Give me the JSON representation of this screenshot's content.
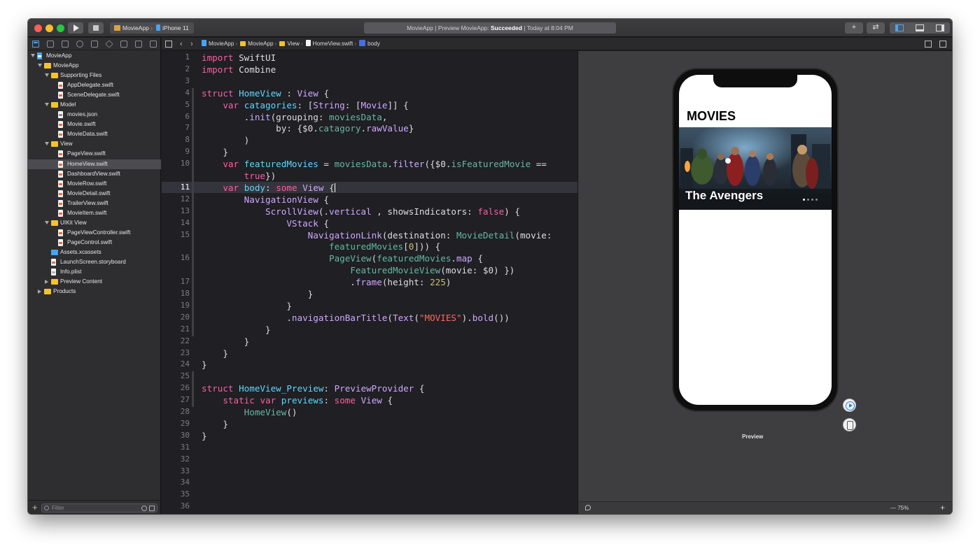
{
  "titlebar": {
    "scheme": "MovieApp",
    "device": "iPhone 11",
    "activity_prefix": "MovieApp | Preview MovieApp: ",
    "activity_status": "Succeeded",
    "activity_suffix": " | Today at 8:04 PM",
    "add_label": "+",
    "swap_label": "⇄"
  },
  "navigator": {
    "items": [
      {
        "label": "MovieApp",
        "kind": "project",
        "depth": 0,
        "disclosure": "open"
      },
      {
        "label": "MovieApp",
        "kind": "folder",
        "depth": 1,
        "disclosure": "open"
      },
      {
        "label": "Supporting Files",
        "kind": "folder",
        "depth": 2,
        "disclosure": "open"
      },
      {
        "label": "AppDelegate.swift",
        "kind": "swift",
        "depth": 3
      },
      {
        "label": "SceneDelegate.swift",
        "kind": "swift",
        "depth": 3
      },
      {
        "label": "Model",
        "kind": "folder",
        "depth": 2,
        "disclosure": "open"
      },
      {
        "label": "movies.json",
        "kind": "json",
        "depth": 3
      },
      {
        "label": "Movie.swift",
        "kind": "swift",
        "depth": 3
      },
      {
        "label": "MovieData.swift",
        "kind": "swift",
        "depth": 3
      },
      {
        "label": "View",
        "kind": "folder",
        "depth": 2,
        "disclosure": "open"
      },
      {
        "label": "PageView.swift",
        "kind": "swift",
        "depth": 3
      },
      {
        "label": "HomeView.swift",
        "kind": "swift",
        "depth": 3,
        "selected": true
      },
      {
        "label": "DashboardView.swift",
        "kind": "swift",
        "depth": 3
      },
      {
        "label": "MovieRow.swift",
        "kind": "swift",
        "depth": 3
      },
      {
        "label": "MovieDetail.swift",
        "kind": "swift",
        "depth": 3
      },
      {
        "label": "TrailerView.swift",
        "kind": "swift",
        "depth": 3
      },
      {
        "label": "MovieItem.swift",
        "kind": "swift",
        "depth": 3
      },
      {
        "label": "UIKit View",
        "kind": "folder",
        "depth": 2,
        "disclosure": "open"
      },
      {
        "label": "PageViewController.swift",
        "kind": "swift",
        "depth": 3
      },
      {
        "label": "PageControl.swift",
        "kind": "swift",
        "depth": 3
      },
      {
        "label": "Assets.xcassets",
        "kind": "assets",
        "depth": 2
      },
      {
        "label": "LaunchScreen.storyboard",
        "kind": "swift",
        "depth": 2
      },
      {
        "label": "Info.plist",
        "kind": "plist",
        "depth": 2
      },
      {
        "label": "Preview Content",
        "kind": "folder",
        "depth": 2,
        "disclosure": "closed"
      },
      {
        "label": "Products",
        "kind": "folder",
        "depth": 1,
        "disclosure": "closed"
      }
    ],
    "filter_placeholder": "Filter",
    "add_label": "+"
  },
  "jumpbar": {
    "crumbs": [
      {
        "label": "MovieApp",
        "icon": "proj"
      },
      {
        "label": "MovieApp",
        "icon": "folder"
      },
      {
        "label": "View",
        "icon": "folder"
      },
      {
        "label": "HomeView.swift",
        "icon": "swift"
      },
      {
        "label": "body",
        "icon": "prop"
      }
    ],
    "back_label": "‹",
    "forward_label": "›"
  },
  "editor": {
    "current_line": 11,
    "lines": [
      {
        "n": "1",
        "tokens": [
          [
            "kw",
            "import"
          ],
          [
            "pl",
            " SwiftUI"
          ]
        ]
      },
      {
        "n": "2",
        "tokens": [
          [
            "kw",
            "import"
          ],
          [
            "pl",
            " Combine"
          ]
        ]
      },
      {
        "n": "3",
        "tokens": []
      },
      {
        "n": "4",
        "tokens": [
          [
            "kw",
            "struct"
          ],
          [
            "pl",
            " "
          ],
          [
            "ty",
            "HomeView"
          ],
          [
            "pl",
            " : "
          ],
          [
            "tp",
            "View"
          ],
          [
            "pl",
            " {"
          ]
        ]
      },
      {
        "n": "5",
        "tokens": [
          [
            "pl",
            "    "
          ],
          [
            "kw",
            "var"
          ],
          [
            "pl",
            " "
          ],
          [
            "ty",
            "catagories"
          ],
          [
            "pl",
            ": ["
          ],
          [
            "tp",
            "String"
          ],
          [
            "pl",
            ": ["
          ],
          [
            "tp",
            "Movie"
          ],
          [
            "pl",
            "]] {"
          ]
        ]
      },
      {
        "n": "6",
        "tokens": [
          [
            "pl",
            "        ."
          ],
          [
            "tp",
            "init"
          ],
          [
            "pl",
            "(grouping: "
          ],
          [
            "fn",
            "moviesData"
          ],
          [
            "pl",
            ","
          ]
        ]
      },
      {
        "n": "7",
        "tokens": [
          [
            "pl",
            "              by: {$0."
          ],
          [
            "fn",
            "catagory"
          ],
          [
            "pl",
            "."
          ],
          [
            "tp",
            "rawValue"
          ],
          [
            "pl",
            "}"
          ]
        ]
      },
      {
        "n": "8",
        "tokens": [
          [
            "pl",
            "        )"
          ]
        ]
      },
      {
        "n": "9",
        "tokens": [
          [
            "pl",
            "    }"
          ]
        ]
      },
      {
        "n": "10",
        "tokens": [
          [
            "pl",
            "    "
          ],
          [
            "kw",
            "var"
          ],
          [
            "pl",
            " "
          ],
          [
            "ty",
            "featuredMovies"
          ],
          [
            "pl",
            " = "
          ],
          [
            "fn",
            "moviesData"
          ],
          [
            "pl",
            "."
          ],
          [
            "tp",
            "filter"
          ],
          [
            "pl",
            "({$0."
          ],
          [
            "fn",
            "isFeaturedMovie"
          ],
          [
            "pl",
            " =="
          ]
        ]
      },
      {
        "n": "",
        "tokens": [
          [
            "pl",
            "        "
          ],
          [
            "kw",
            "true"
          ],
          [
            "pl",
            "})"
          ]
        ]
      },
      {
        "n": "11",
        "tokens": [
          [
            "pl",
            "    "
          ],
          [
            "kw",
            "var"
          ],
          [
            "pl",
            " "
          ],
          [
            "ty",
            "body"
          ],
          [
            "pl",
            ": "
          ],
          [
            "kw",
            "some"
          ],
          [
            "pl",
            " "
          ],
          [
            "tp",
            "View"
          ],
          [
            "pl",
            " {"
          ]
        ],
        "cursor": true
      },
      {
        "n": "12",
        "tokens": [
          [
            "pl",
            "        "
          ],
          [
            "tp",
            "NavigationView"
          ],
          [
            "pl",
            " {"
          ]
        ]
      },
      {
        "n": "13",
        "tokens": [
          [
            "pl",
            "            "
          ],
          [
            "tp",
            "ScrollView"
          ],
          [
            "pl",
            "(."
          ],
          [
            "tp",
            "vertical"
          ],
          [
            "pl",
            " , showsIndicators: "
          ],
          [
            "kw",
            "false"
          ],
          [
            "pl",
            ") {"
          ]
        ]
      },
      {
        "n": "14",
        "tokens": [
          [
            "pl",
            "                "
          ],
          [
            "tp",
            "VStack"
          ],
          [
            "pl",
            " {"
          ]
        ]
      },
      {
        "n": "15",
        "tokens": [
          [
            "pl",
            "                    "
          ],
          [
            "tp",
            "NavigationLink"
          ],
          [
            "pl",
            "(destination: "
          ],
          [
            "fn",
            "MovieDetail"
          ],
          [
            "pl",
            "(movie:"
          ]
        ]
      },
      {
        "n": "",
        "tokens": [
          [
            "pl",
            "                        "
          ],
          [
            "fn",
            "featuredMovies"
          ],
          [
            "pl",
            "["
          ],
          [
            "nm",
            "0"
          ],
          [
            "pl",
            "])) {"
          ]
        ]
      },
      {
        "n": "16",
        "tokens": [
          [
            "pl",
            "                        "
          ],
          [
            "fn",
            "PageView"
          ],
          [
            "pl",
            "("
          ],
          [
            "fn",
            "featuredMovies"
          ],
          [
            "pl",
            "."
          ],
          [
            "tp",
            "map"
          ],
          [
            "pl",
            " {"
          ]
        ]
      },
      {
        "n": "",
        "tokens": [
          [
            "pl",
            "                            "
          ],
          [
            "fn",
            "FeaturedMovieView"
          ],
          [
            "pl",
            "(movie: $0) })"
          ]
        ]
      },
      {
        "n": "17",
        "tokens": [
          [
            "pl",
            "                            ."
          ],
          [
            "tp",
            "frame"
          ],
          [
            "pl",
            "(height: "
          ],
          [
            "nm",
            "225"
          ],
          [
            "pl",
            ")"
          ]
        ]
      },
      {
        "n": "18",
        "tokens": [
          [
            "pl",
            "                    }"
          ]
        ]
      },
      {
        "n": "19",
        "tokens": [
          [
            "pl",
            "                }"
          ]
        ]
      },
      {
        "n": "20",
        "tokens": [
          [
            "pl",
            "                ."
          ],
          [
            "tp",
            "navigationBarTitle"
          ],
          [
            "pl",
            "("
          ],
          [
            "tp",
            "Text"
          ],
          [
            "pl",
            "("
          ],
          [
            "st",
            "\"MOVIES\""
          ],
          [
            "pl",
            ")."
          ],
          [
            "tp",
            "bold"
          ],
          [
            "pl",
            "())"
          ]
        ]
      },
      {
        "n": "21",
        "tokens": [
          [
            "pl",
            "            }"
          ]
        ]
      },
      {
        "n": "22",
        "tokens": [
          [
            "pl",
            "        }"
          ]
        ]
      },
      {
        "n": "23",
        "tokens": [
          [
            "pl",
            "    }"
          ]
        ]
      },
      {
        "n": "24",
        "tokens": [
          [
            "pl",
            "}"
          ]
        ]
      },
      {
        "n": "25",
        "tokens": []
      },
      {
        "n": "26",
        "tokens": [
          [
            "kw",
            "struct"
          ],
          [
            "pl",
            " "
          ],
          [
            "ty",
            "HomeView_Preview"
          ],
          [
            "pl",
            ": "
          ],
          [
            "tp",
            "PreviewProvider"
          ],
          [
            "pl",
            " {"
          ]
        ]
      },
      {
        "n": "27",
        "tokens": [
          [
            "pl",
            "    "
          ],
          [
            "kw",
            "static"
          ],
          [
            "pl",
            " "
          ],
          [
            "kw",
            "var"
          ],
          [
            "pl",
            " "
          ],
          [
            "ty",
            "previews"
          ],
          [
            "pl",
            ": "
          ],
          [
            "kw",
            "some"
          ],
          [
            "pl",
            " "
          ],
          [
            "tp",
            "View"
          ],
          [
            "pl",
            " {"
          ]
        ]
      },
      {
        "n": "28",
        "tokens": [
          [
            "pl",
            "        "
          ],
          [
            "fn",
            "HomeView"
          ],
          [
            "pl",
            "()"
          ]
        ]
      },
      {
        "n": "29",
        "tokens": [
          [
            "pl",
            "    }"
          ]
        ]
      },
      {
        "n": "30",
        "tokens": [
          [
            "pl",
            "}"
          ]
        ]
      },
      {
        "n": "31",
        "tokens": []
      },
      {
        "n": "32",
        "tokens": []
      },
      {
        "n": "33",
        "tokens": []
      },
      {
        "n": "34",
        "tokens": []
      },
      {
        "n": "35",
        "tokens": []
      },
      {
        "n": "36",
        "tokens": []
      }
    ]
  },
  "preview": {
    "nav_title": "MOVIES",
    "featured_title": "The Avengers",
    "label": "Preview",
    "zoom": "75%",
    "zoom_plus": "+"
  },
  "colors": {
    "keyword": "#fc5fa3",
    "decl": "#5dd8ff",
    "type": "#d0a8ff",
    "project_ref": "#67b7a4",
    "string": "#fc6a5d",
    "number": "#d0bf69",
    "plain": "#dfdfe0"
  }
}
